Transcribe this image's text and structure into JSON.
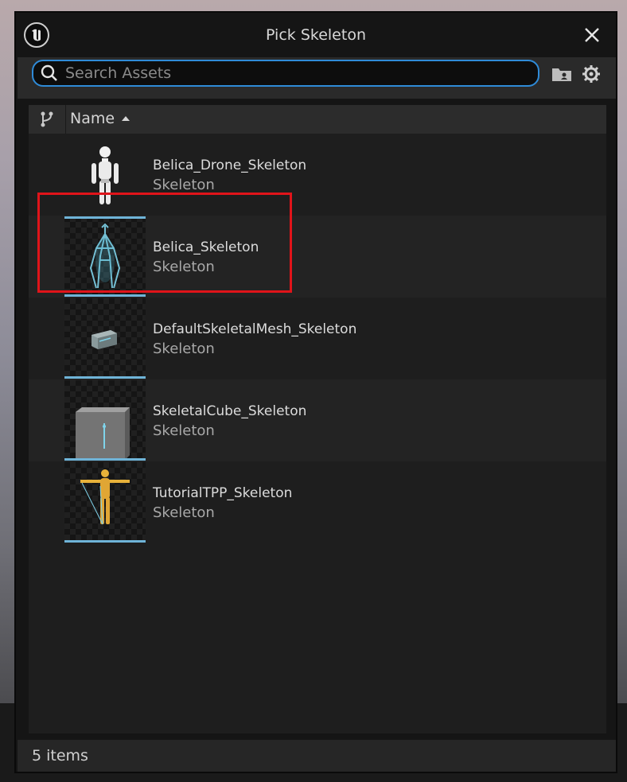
{
  "window": {
    "title": "Pick Skeleton"
  },
  "search": {
    "placeholder": "Search Assets",
    "value": ""
  },
  "columns": {
    "name_header": "Name",
    "sort_direction": "ascending"
  },
  "assets": [
    {
      "name": "Belica_Drone_Skeleton",
      "type": "Skeleton",
      "selected": false
    },
    {
      "name": "Belica_Skeleton",
      "type": "Skeleton",
      "selected": true
    },
    {
      "name": "DefaultSkeletalMesh_Skeleton",
      "type": "Skeleton",
      "selected": false
    },
    {
      "name": "SkeletalCube_Skeleton",
      "type": "Skeleton",
      "selected": false
    },
    {
      "name": "TutorialTPP_Skeleton",
      "type": "Skeleton",
      "selected": false
    }
  ],
  "footer": {
    "item_count": "5 items"
  },
  "colors": {
    "accent": "#2f8bd8",
    "thumb_bar": "#6fb4d8",
    "highlight": "#e0141a"
  },
  "icons": {
    "logo": "unreal-engine-logo-icon",
    "close": "close-icon",
    "search": "search-icon",
    "folder": "folder-icon",
    "settings": "gear-icon",
    "hierarchy": "branch-icon",
    "sort": "sort-ascending-icon"
  }
}
